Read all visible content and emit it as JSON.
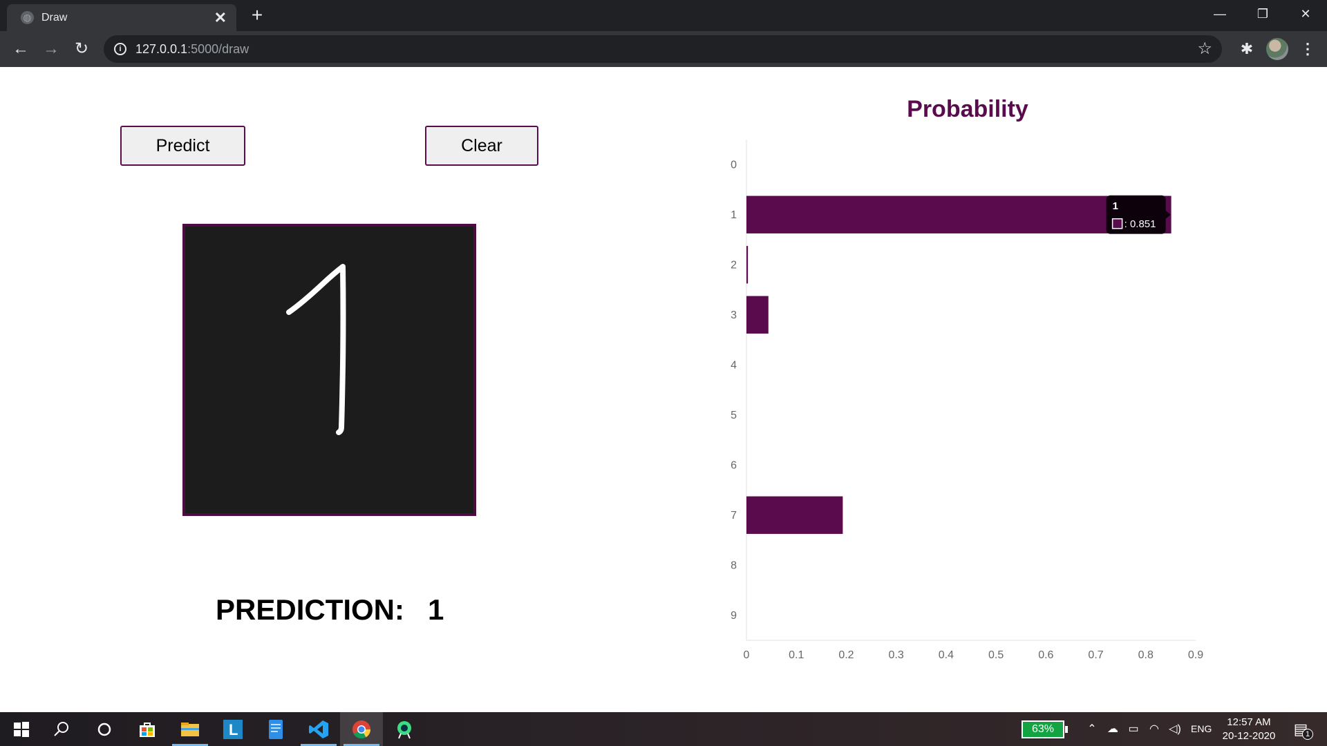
{
  "browser": {
    "tab_title": "Draw",
    "tab_close": "✕",
    "new_tab": "+",
    "window_controls": {
      "minimize": "—",
      "restore": "❐",
      "close": "✕"
    },
    "nav": {
      "back": "←",
      "forward": "→",
      "reload": "↻"
    },
    "address": {
      "host": "127.0.0.1",
      "path": ":5000/draw"
    },
    "icons": [
      "info-icon",
      "star-icon",
      "extensions-icon",
      "profile-avatar",
      "menu-icon"
    ]
  },
  "page": {
    "predict_label": "Predict",
    "clear_label": "Clear",
    "prediction_label": "PREDICTION:",
    "prediction_value": "1",
    "colors": {
      "accent": "#5a0b4d",
      "canvas_bg": "#1c1c1c",
      "stroke": "#ffffff"
    }
  },
  "chart_data": {
    "type": "bar",
    "orientation": "horizontal",
    "title": "Probability",
    "categories": [
      "0",
      "1",
      "2",
      "3",
      "4",
      "5",
      "6",
      "7",
      "8",
      "9"
    ],
    "values": [
      0.0,
      0.851,
      0.003,
      0.044,
      0.0,
      0.0,
      0.0,
      0.193,
      0.0,
      0.0
    ],
    "xlim": [
      0,
      0.9
    ],
    "xticks": [
      "0",
      "0.1",
      "0.2",
      "0.3",
      "0.4",
      "0.5",
      "0.6",
      "0.7",
      "0.8",
      "0.9"
    ],
    "grid": false,
    "bar_color": "#5a0b4d",
    "tooltip": {
      "category": "1",
      "text": ": 0.851"
    }
  },
  "taskbar": {
    "apps": [
      "windows-start-icon",
      "search-icon",
      "cortana-icon",
      "store-icon",
      "file-explorer-icon",
      "l-app-icon",
      "notepad-icon",
      "vscode-icon",
      "chrome-icon",
      "android-studio-icon"
    ],
    "battery": "63%",
    "language": "ENG",
    "time": "12:57 AM",
    "date": "20-12-2020",
    "notification_count": "1"
  }
}
